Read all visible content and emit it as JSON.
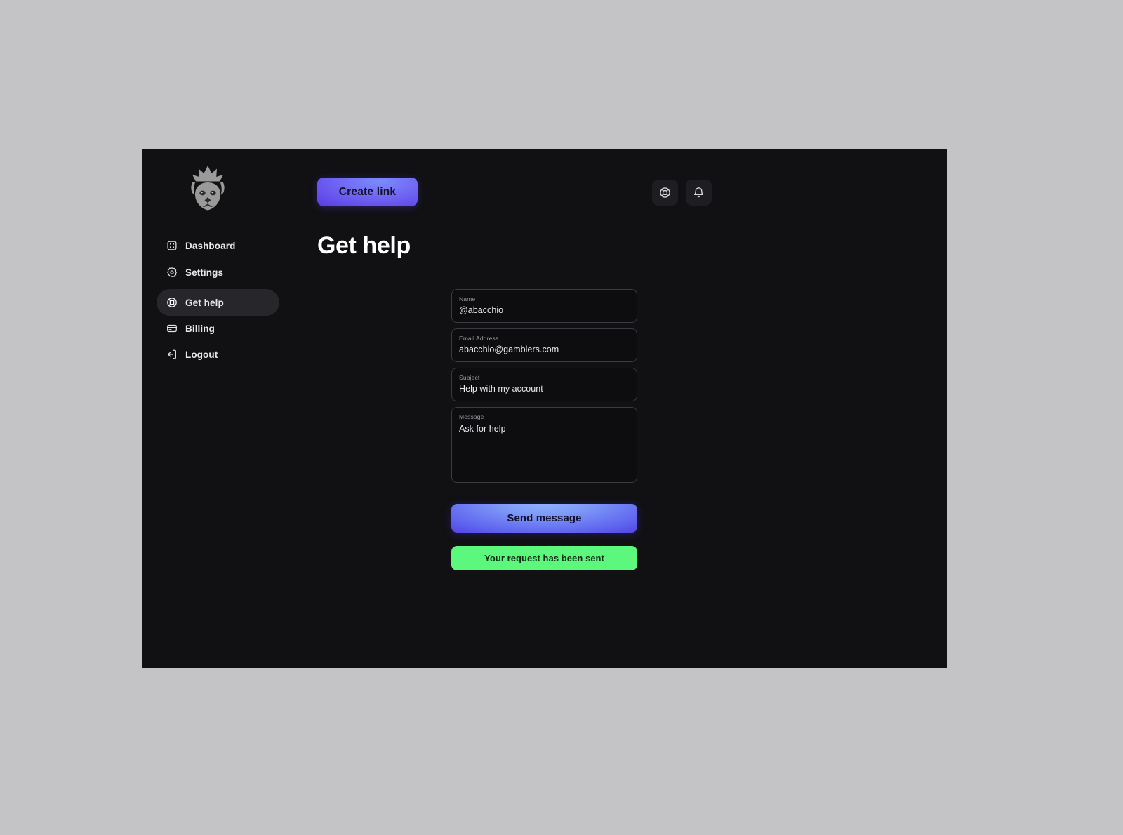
{
  "header": {
    "logo_name": "crowned-lion-logo",
    "create_link_label": "Create link",
    "help_icon": "lifebuoy-icon",
    "notifications_icon": "bell-icon"
  },
  "sidebar": {
    "items": [
      {
        "label": "Dashboard",
        "icon": "dashboard-dice-icon",
        "active": false
      },
      {
        "label": "Settings",
        "icon": "gear-icon",
        "active": false
      },
      {
        "label": "Get help",
        "icon": "lifebuoy-icon",
        "active": true
      },
      {
        "label": "Billing",
        "icon": "credit-card-icon",
        "active": false
      },
      {
        "label": "Logout",
        "icon": "logout-arrow-icon",
        "active": false
      }
    ]
  },
  "main": {
    "title": "Get help",
    "form": {
      "fields": [
        {
          "label": "Name",
          "value": "@abacchio"
        },
        {
          "label": "Email Address",
          "value": "abacchio@gamblers.com"
        },
        {
          "label": "Subject",
          "value": "Help with my account"
        },
        {
          "label": "Message",
          "value": "Ask for help"
        }
      ],
      "submit_label": "Send message",
      "status_message": "Your request has been sent"
    }
  },
  "colors": {
    "page_background": "#c4c4c6",
    "app_background": "#111113",
    "accent_purple": "#5b3fe6",
    "accent_blue": "#7e9cf8",
    "success_green": "#5cf77d",
    "active_nav": "#26262b",
    "field_border": "#3a3a40"
  }
}
